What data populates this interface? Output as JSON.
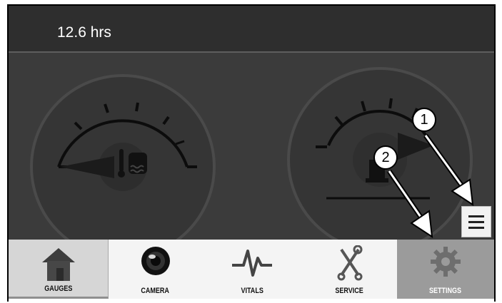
{
  "header": {
    "hours": "12.6 hrs"
  },
  "gauges": [
    {
      "name": "coolant-temperature-gauge",
      "icon": "coolant-temperature-icon"
    },
    {
      "name": "fuel-gauge",
      "icon": "fuel-pump-icon"
    }
  ],
  "menu_button": {
    "icon": "hamburger-menu-icon"
  },
  "nav": {
    "tabs": [
      {
        "label": "GAUGES",
        "icon": "house-icon",
        "selected": true
      },
      {
        "label": "CAMERA",
        "icon": "camera-lens-icon",
        "selected": false
      },
      {
        "label": "VITALS",
        "icon": "pulse-wave-icon",
        "selected": false
      },
      {
        "label": "SERVICE",
        "icon": "wrench-screwdriver-icon",
        "selected": false
      },
      {
        "label": "SETTINGS",
        "icon": "gear-icon",
        "selected": false
      }
    ]
  },
  "callouts": [
    {
      "number": "1",
      "target": "menu button"
    },
    {
      "number": "2",
      "target": "settings tab"
    }
  ],
  "colors": {
    "header_bg": "#2e2e2e",
    "gauge_area_bg": "#3b3b3b",
    "nav_selected_bg": "#d6d6d6",
    "nav_settings_bg": "#9b9b9b",
    "nav_bg": "#f4f4f4"
  }
}
